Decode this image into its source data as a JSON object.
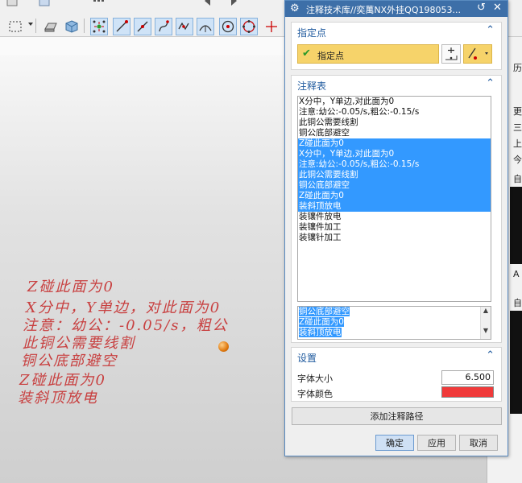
{
  "dialog": {
    "title": "注释技术库//奕萬NX外挂QQ198053...",
    "icons": [
      "gear-icon",
      "reset-icon",
      "close-icon"
    ]
  },
  "specify_point": {
    "title": "指定点",
    "pick_label": "指定点"
  },
  "annotation_table": {
    "title": "注释表",
    "items": [
      {
        "text": "X分中，Y单边,对此面为0",
        "selected": false
      },
      {
        "text": "注意:幼公:-0.05/s,粗公:-0.15/s",
        "selected": false
      },
      {
        "text": "此铜公需要线割",
        "selected": false
      },
      {
        "text": "铜公底部避空",
        "selected": false
      },
      {
        "text": "Z碰此面为0",
        "selected": true
      },
      {
        "text": "X分中，Y单边,对此面为0",
        "selected": true
      },
      {
        "text": "注意:幼公:-0.05/s,粗公:-0.15/s",
        "selected": true
      },
      {
        "text": "此铜公需要线割",
        "selected": true
      },
      {
        "text": "铜公底部避空",
        "selected": true
      },
      {
        "text": "Z碰此面为0",
        "selected": true
      },
      {
        "text": "装斜顶放电",
        "selected": true
      },
      {
        "text": "装镶件放电",
        "selected": false
      },
      {
        "text": "装镶件加工",
        "selected": false
      },
      {
        "text": "装镶针加工",
        "selected": false
      }
    ],
    "memo_lines": [
      "铜公底部避空",
      "Z碰此面为0",
      "装斜顶放电"
    ]
  },
  "settings": {
    "title": "设置",
    "font_size_label": "字体大小",
    "font_size_value": "6.500",
    "font_color_label": "字体颜色",
    "font_color": "#f03a3a"
  },
  "buttons": {
    "add_path": "添加注释路径",
    "ok": "确定",
    "apply": "应用",
    "cancel": "取消"
  },
  "viewport_annotations": [
    "Z碰此面为0",
    "X分中，Y单边，对此面为0",
    "注意：幼公：-0.05/s，粗公",
    "此铜公需要线割",
    "铜公底部避空",
    "Z碰此面为0",
    "装斜顶放电"
  ],
  "side_panel": {
    "labels": [
      "历",
      "更",
      "三",
      "上",
      "今",
      "自",
      "A",
      "自"
    ]
  }
}
